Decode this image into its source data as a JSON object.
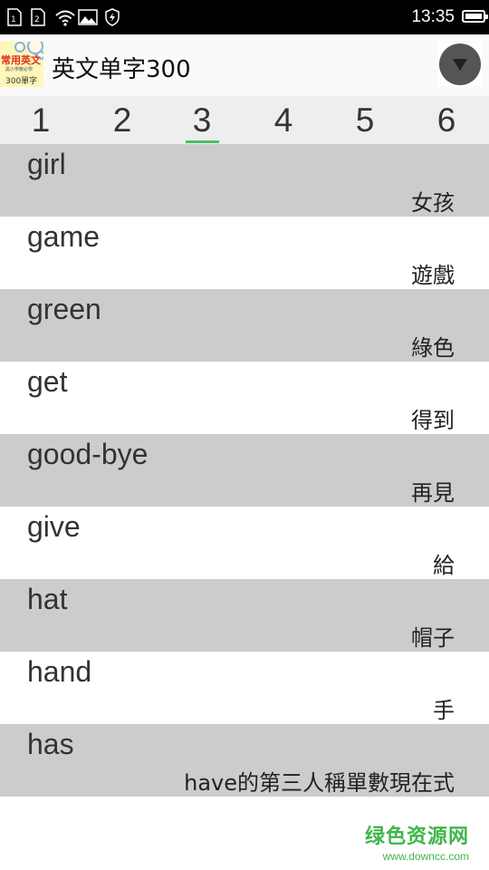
{
  "status_bar": {
    "time": "13:35",
    "icons": [
      "sim1-icon",
      "sim2-icon",
      "wifi-icon",
      "image-icon",
      "shield-icon",
      "battery-icon"
    ]
  },
  "app": {
    "title": "英文单字300",
    "logo": {
      "line1": "常用英文",
      "line2": "黑小學教必學",
      "line3": "300單字"
    },
    "menu_icon": "dropdown-arrow-icon"
  },
  "tabs": {
    "items": [
      "1",
      "2",
      "3",
      "4",
      "5",
      "6"
    ],
    "selected": "3",
    "accent_color": "#4cc164"
  },
  "words": [
    {
      "en": "girl",
      "zh": "女孩"
    },
    {
      "en": "game",
      "zh": "遊戲"
    },
    {
      "en": "green",
      "zh": "綠色"
    },
    {
      "en": "get",
      "zh": "得到"
    },
    {
      "en": "good-bye",
      "zh": "再見"
    },
    {
      "en": "give",
      "zh": "給"
    },
    {
      "en": "hat",
      "zh": "帽子"
    },
    {
      "en": "hand",
      "zh": "手"
    },
    {
      "en": "has",
      "zh": "have的第三人稱單數現在式"
    }
  ],
  "colors": {
    "row_gray": "#cccccc",
    "row_white": "#ffffff"
  },
  "watermark": {
    "main": "绿色资源网",
    "sub": "www.downcc.com"
  }
}
